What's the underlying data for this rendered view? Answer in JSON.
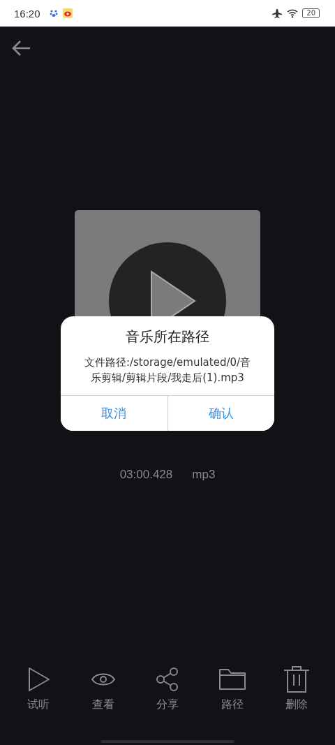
{
  "status_bar": {
    "time": "16:20",
    "battery": "20"
  },
  "track": {
    "duration": "03:00.428",
    "format": "mp3"
  },
  "dialog": {
    "title": "音乐所在路径",
    "message": "文件路径:/storage/emulated/0/音乐剪辑/剪辑片段/我走后(1).mp3",
    "buttons": [
      {
        "kind": "cancel",
        "label": "取消"
      },
      {
        "kind": "confirm",
        "label": "确认"
      }
    ]
  },
  "toolbar": [
    {
      "kind": "play",
      "label": "试听"
    },
    {
      "kind": "view",
      "label": "查看"
    },
    {
      "kind": "share",
      "label": "分享"
    },
    {
      "kind": "folder",
      "label": "路径"
    },
    {
      "kind": "delete",
      "label": "删除"
    }
  ]
}
